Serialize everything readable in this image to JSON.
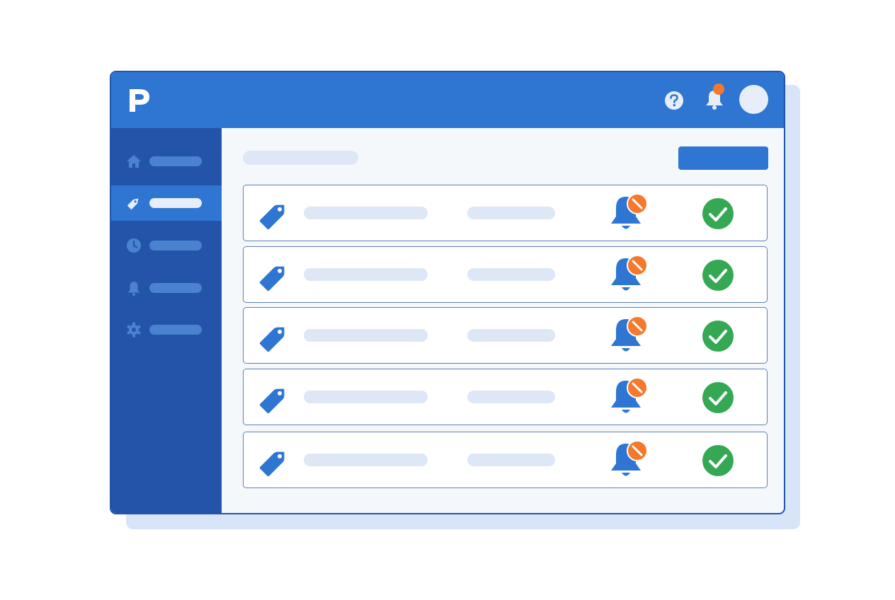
{
  "colors": {
    "header_blue": "#2e76d2",
    "sidebar_blue": "#2454a9",
    "alert_orange": "#f5792c",
    "success_green": "#34a853",
    "placeholder_bar": "#dde7f5",
    "content_bg": "#f5f8fb"
  },
  "header": {
    "logo_icon": "p-logo-icon",
    "actions": [
      "help-icon",
      "notification-bell-icon",
      "user-avatar"
    ],
    "notification_badge": true
  },
  "sidebar": {
    "items": [
      {
        "icon": "home-icon",
        "active": false
      },
      {
        "icon": "tag-icon",
        "active": true
      },
      {
        "icon": "clock-icon",
        "active": false
      },
      {
        "icon": "bell-icon",
        "active": false
      },
      {
        "icon": "gear-icon",
        "active": false
      }
    ]
  },
  "main": {
    "rows": [
      {
        "icon": "tag-icon",
        "notification_icon": "bell-muted-icon",
        "status_icon": "check-circle-icon",
        "status": "ok"
      },
      {
        "icon": "tag-icon",
        "notification_icon": "bell-muted-icon",
        "status_icon": "check-circle-icon",
        "status": "ok"
      },
      {
        "icon": "tag-icon",
        "notification_icon": "bell-muted-icon",
        "status_icon": "check-circle-icon",
        "status": "ok"
      },
      {
        "icon": "tag-icon",
        "notification_icon": "bell-muted-icon",
        "status_icon": "check-circle-icon",
        "status": "ok"
      },
      {
        "icon": "tag-icon",
        "notification_icon": "bell-muted-icon",
        "status_icon": "check-circle-icon",
        "status": "ok"
      }
    ]
  }
}
